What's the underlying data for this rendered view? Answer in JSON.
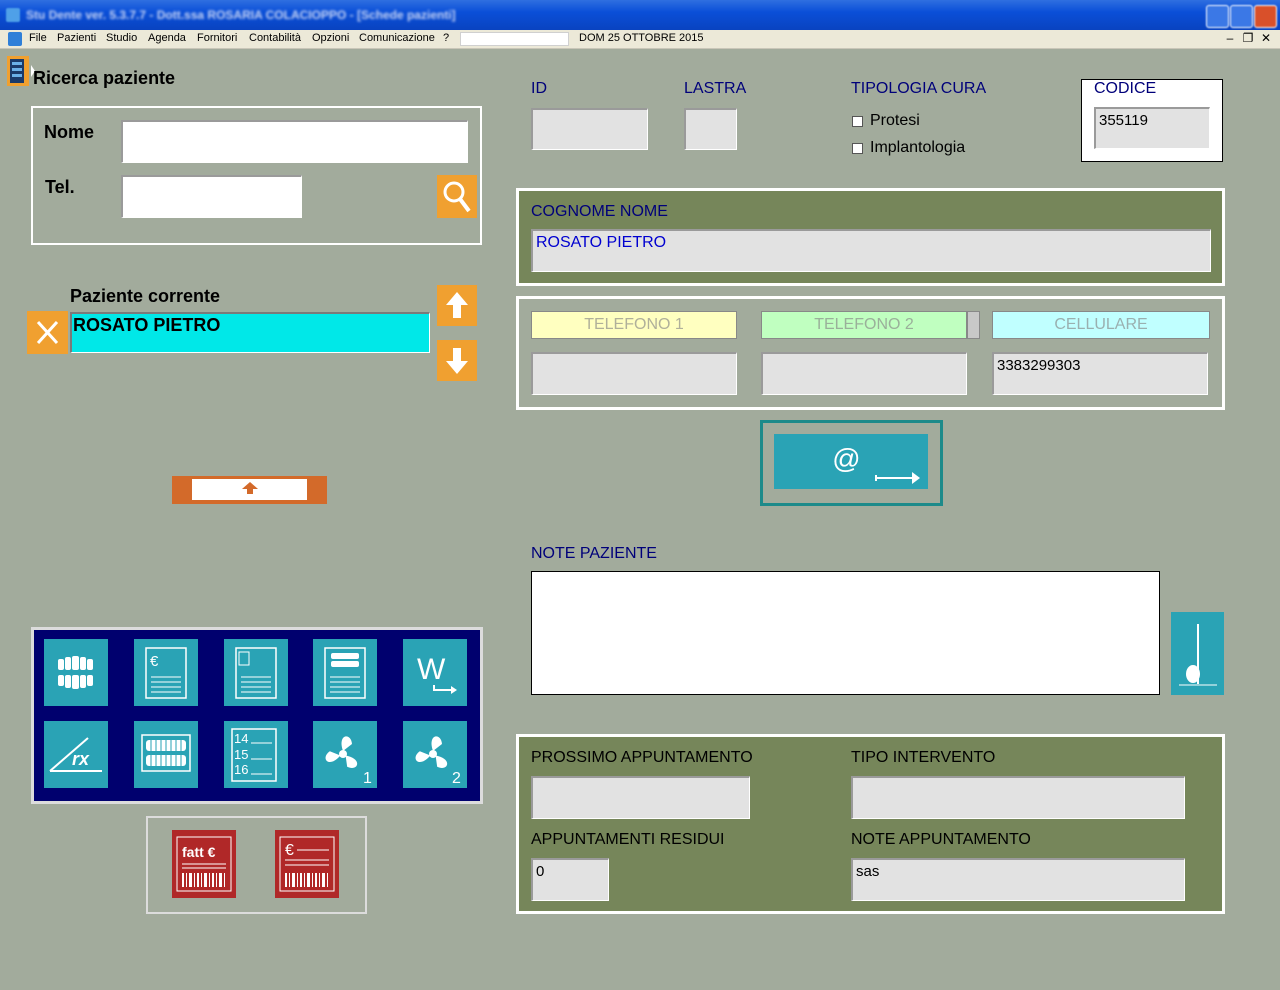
{
  "titlebar": {
    "title": "Stu Dente ver. 5.3.7.7 - Dott.ssa ROSARIA COLACIOPPO - [Schede pazienti]"
  },
  "menubar": {
    "items": [
      "File",
      "Pazienti",
      "Studio",
      "Agenda",
      "Fornitori",
      "Contabilità",
      "Opzioni",
      "Comunicazione",
      "?"
    ],
    "date": "DOM 25 OTTOBRE 2015",
    "mdi_min": "–",
    "mdi_restore": "❐",
    "mdi_close": "✕"
  },
  "search": {
    "title": "Ricerca paziente",
    "nome_label": "Nome",
    "nome_value": "",
    "tel_label": "Tel.",
    "tel_value": ""
  },
  "current": {
    "label": "Paziente corrente",
    "value": "ROSATO PIETRO"
  },
  "header": {
    "id_label": "ID",
    "id_value": "",
    "lastra_label": "LASTRA",
    "lastra_value": "",
    "tipologia_label": "TIPOLOGIA CURA",
    "protesi_label": "Protesi",
    "implantologia_label": "Implantologia",
    "codice_label": "CODICE",
    "codice_value": "355119"
  },
  "patient": {
    "cognome_label": "COGNOME NOME",
    "cognome_value": "ROSATO PIETRO"
  },
  "phones": {
    "tel1_label": "TELEFONO 1",
    "tel1_value": "",
    "tel2_label": "TELEFONO 2",
    "tel2_value": "",
    "cell_label": "CELLULARE",
    "cell_value": "3383299303"
  },
  "notes": {
    "label": "NOTE PAZIENTE",
    "value": ""
  },
  "appointments": {
    "prossimo_label": "PROSSIMO APPUNTAMENTO",
    "prossimo_value": "",
    "tipo_label": "TIPO INTERVENTO",
    "tipo_value": "",
    "residui_label": "APPUNTAMENTI RESIDUI",
    "residui_value": "0",
    "note_label": "NOTE APPUNTAMENTO",
    "note_value": "sas"
  },
  "toolbar_icons": {
    "row1": [
      "teeth-icon",
      "euro-document-icon",
      "blank-document-icon",
      "teeth-document-icon",
      "w-export-icon"
    ],
    "row2": [
      "rx-icon",
      "dental-arch-icon",
      "numbered-list-icon",
      "fan-1-icon",
      "fan-2-icon"
    ],
    "fan1_num": "1",
    "fan2_num": "2"
  },
  "invoice": {
    "fatt_label": "fatt  €",
    "euro_label": "€"
  },
  "colors": {
    "background": "#a2ab9c",
    "olive_panel": "#76865a",
    "navy_panel": "#00006e",
    "teal": "#2aa3b5",
    "orange": "#f0a030",
    "red": "#b02828",
    "cyan": "#00e8e8",
    "tel1": "#ffffc0",
    "tel2": "#c0ffc0",
    "cell": "#c0ffff",
    "navy_text": "#00007a"
  }
}
